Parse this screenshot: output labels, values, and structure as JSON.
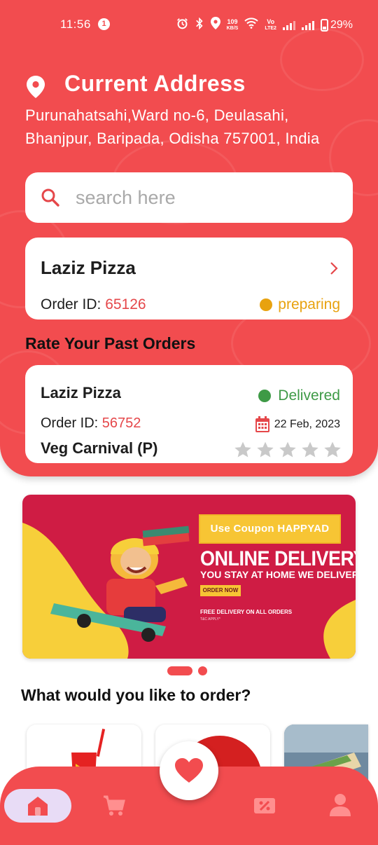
{
  "status_bar": {
    "time": "11:56",
    "notification_count": "1",
    "net_speed_value": "109",
    "net_speed_unit": "KB/S",
    "volte_top": "Vo",
    "volte_bottom": "LTE2",
    "battery": "29%"
  },
  "address": {
    "title": "Current Address",
    "line1": "Purunahatsahi,Ward no-6, Deulasahi,",
    "line2": "Bhanjpur, Baripada, Odisha 757001, India"
  },
  "search": {
    "placeholder": "search here"
  },
  "current_order": {
    "restaurant": "Laziz Pizza",
    "order_id_label": "Order ID: ",
    "order_id": "65126",
    "status": "preparing",
    "status_color": "#e8a20f"
  },
  "rate_section": {
    "title": "Rate Your Past Orders"
  },
  "past_order": {
    "restaurant": "Laziz Pizza",
    "status": "Delivered",
    "status_color": "#3e9a46",
    "order_id_label": "Order ID: ",
    "order_id": "56752",
    "date": "22 Feb, 2023",
    "item": "Veg Carnival  (P)",
    "rating": 0,
    "max_rating": 5
  },
  "banner": {
    "coupon": "Use Coupon HAPPYAD",
    "title": "ONLINE DELIVERY",
    "subtitle": "YOU STAY AT HOME WE DELIVER",
    "button": "ORDER NOW",
    "free_delivery": "FREE DELIVERY ON ALL ORDERS",
    "tc": "T&C APPLY*",
    "active_page": 1,
    "page_count": 2
  },
  "categories_section": {
    "title": "What would you like to order?"
  },
  "nav": {
    "items": [
      "home-icon",
      "cart-icon",
      "heart-icon",
      "discount-icon",
      "profile-icon"
    ],
    "active": "home-icon"
  },
  "colors": {
    "brand": "#f24c4f",
    "id_red": "#e5474a",
    "nav_active_bg": "#e8dcf6"
  }
}
